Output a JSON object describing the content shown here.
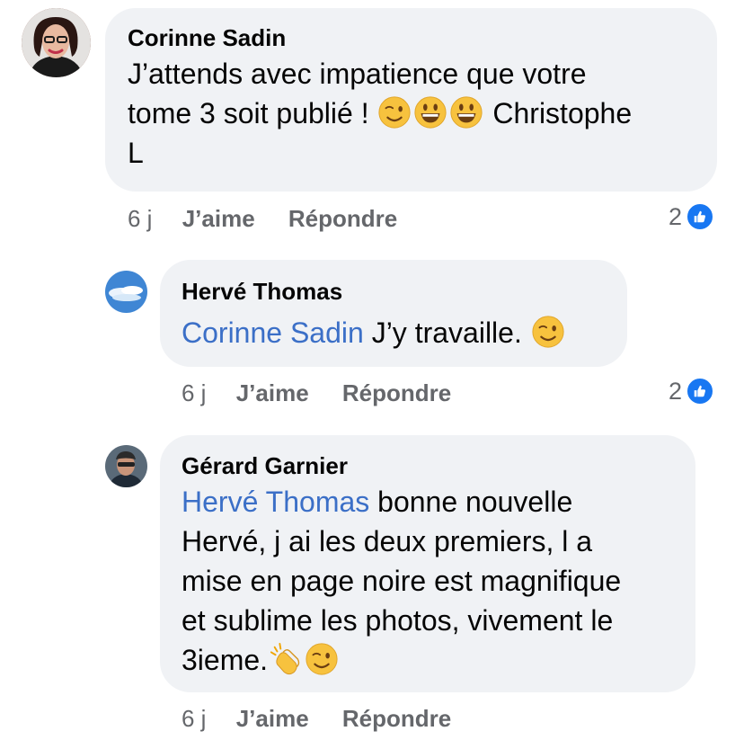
{
  "comments": [
    {
      "author": "Corinne Sadin",
      "line1": "J’attends avec impatience que votre",
      "line2_text": "tome 3 soit publié !",
      "line2_tail": "Christophe",
      "line3": "L",
      "emojis": [
        "wink-emoji",
        "grin-emoji",
        "grin-emoji"
      ],
      "time": "6 j",
      "like_label": "J’aime",
      "reply_label": "Répondre",
      "reaction_count": "2"
    },
    {
      "author": "Hervé Thomas",
      "mention": "Corinne Sadin",
      "text": "J’y travaille.",
      "emojis": [
        "wink-emoji"
      ],
      "time": "6 j",
      "like_label": "J’aime",
      "reply_label": "Répondre",
      "reaction_count": "2"
    },
    {
      "author": "Gérard Garnier",
      "mention": "Hervé Thomas",
      "line1_tail": "bonne nouvelle",
      "line2": "Hervé, j ai les deux premiers, l a",
      "line3": "mise en page noire est magnifique",
      "line4": "et sublime les photos, vivement le",
      "line5": "3ieme.",
      "emojis": [
        "clapping-hands-emoji",
        "wink-emoji"
      ],
      "time": "6 j",
      "like_label": "J’aime",
      "reply_label": "Répondre"
    }
  ],
  "colors": {
    "bubble": "#f0f2f5",
    "mention": "#3b6fc7",
    "meta": "#65676b",
    "like_badge": "#1877f2"
  }
}
